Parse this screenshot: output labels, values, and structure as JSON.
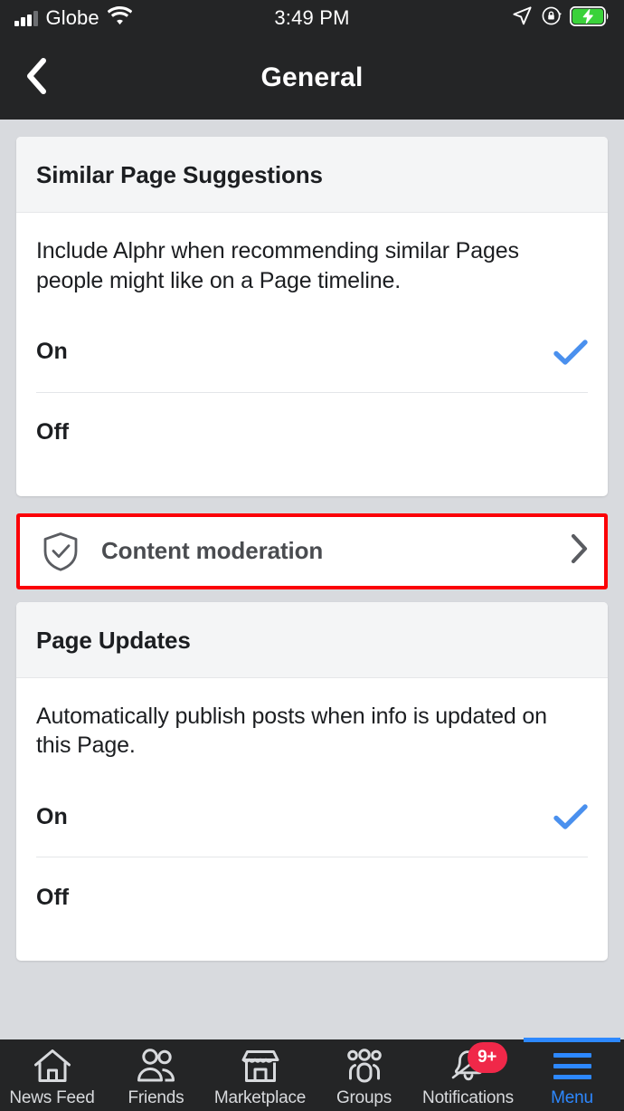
{
  "statusbar": {
    "carrier": "Globe",
    "time": "3:49 PM",
    "signal_icon": "signal-bars-icon",
    "wifi_icon": "wifi-icon",
    "location_icon": "location-arrow-icon",
    "rotation_lock_icon": "rotation-lock-icon",
    "battery_icon": "battery-charging-icon",
    "battery_color": "#3ad23a"
  },
  "header": {
    "title": "General",
    "back_icon": "chevron-left-icon"
  },
  "sections": [
    {
      "title": "Similar Page Suggestions",
      "description": "Include Alphr when recommending similar Pages people might like on a Page timeline.",
      "options": [
        {
          "label": "On",
          "selected": true
        },
        {
          "label": "Off",
          "selected": false
        }
      ]
    },
    {
      "title": "Page Updates",
      "description": "Automatically publish posts when info is updated on this Page.",
      "options": [
        {
          "label": "On",
          "selected": true
        },
        {
          "label": "Off",
          "selected": false
        }
      ]
    }
  ],
  "content_moderation": {
    "label": "Content moderation",
    "icon": "shield-check-icon",
    "chevron_icon": "chevron-right-icon",
    "highlight_color": "#fb0007"
  },
  "colors": {
    "accent_blue": "#4a90ee",
    "page_background": "#d8dade",
    "card_background": "#ffffff",
    "card_header_background": "#f4f5f6",
    "nav_background": "#242526",
    "badge_red": "#f02849",
    "active_blue": "#2d88ff"
  },
  "bottomnav": {
    "tabs": [
      {
        "label": "News Feed",
        "icon": "home-icon",
        "active": false,
        "badge": ""
      },
      {
        "label": "Friends",
        "icon": "friends-icon",
        "active": false,
        "badge": ""
      },
      {
        "label": "Marketplace",
        "icon": "marketplace-icon",
        "active": false,
        "badge": ""
      },
      {
        "label": "Groups",
        "icon": "groups-icon",
        "active": false,
        "badge": ""
      },
      {
        "label": "Notifications",
        "icon": "bell-icon",
        "active": false,
        "badge": "9+"
      },
      {
        "label": "Menu",
        "icon": "hamburger-menu-icon",
        "active": true,
        "badge": ""
      }
    ]
  }
}
